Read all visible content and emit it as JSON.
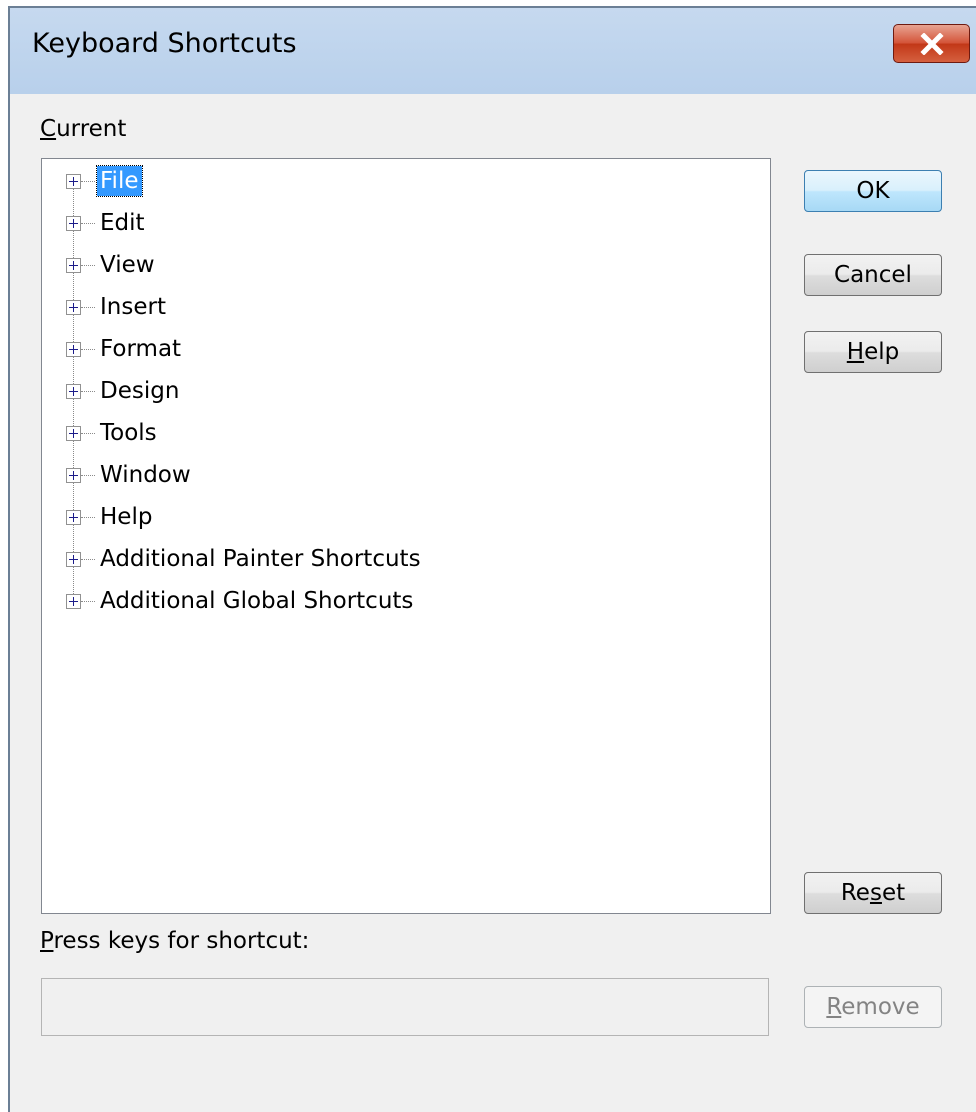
{
  "dialog": {
    "title": "Keyboard Shortcuts",
    "close_icon": "close-icon"
  },
  "current_label": {
    "mnemonic": "C",
    "rest": "urrent"
  },
  "tree": {
    "items": [
      {
        "label": "File",
        "selected": true
      },
      {
        "label": "Edit",
        "selected": false
      },
      {
        "label": "View",
        "selected": false
      },
      {
        "label": "Insert",
        "selected": false
      },
      {
        "label": "Format",
        "selected": false
      },
      {
        "label": "Design",
        "selected": false
      },
      {
        "label": "Tools",
        "selected": false
      },
      {
        "label": "Window",
        "selected": false
      },
      {
        "label": "Help",
        "selected": false
      },
      {
        "label": "Additional Painter Shortcuts",
        "selected": false
      },
      {
        "label": "Additional Global Shortcuts",
        "selected": false
      }
    ]
  },
  "buttons": {
    "ok": "OK",
    "cancel": "Cancel",
    "help": {
      "mnemonic": "H",
      "rest": "elp"
    },
    "reset": {
      "pre": "Re",
      "mnemonic": "s",
      "post": "et"
    },
    "remove": {
      "mnemonic": "R",
      "rest": "emove"
    }
  },
  "shortcut_label": {
    "mnemonic": "P",
    "rest": "ress keys for shortcut:"
  },
  "shortcut_input": {
    "value": ""
  },
  "colors": {
    "selection": "#3399ff",
    "titlebar": "#c6d9ef",
    "close": "#c23818"
  }
}
